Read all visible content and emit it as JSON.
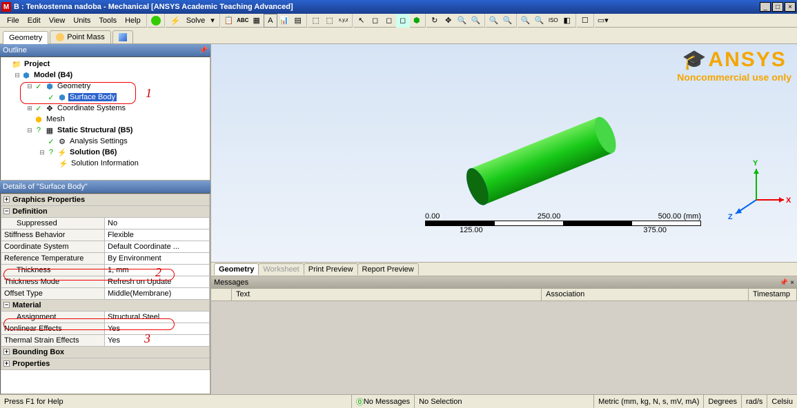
{
  "title": "B : Tenkostenna nadoba - Mechanical [ANSYS Academic Teaching Advanced]",
  "menu": [
    "File",
    "Edit",
    "View",
    "Units",
    "Tools",
    "Help"
  ],
  "solve_label": "Solve",
  "tabs": {
    "geometry": "Geometry",
    "pointmass": "Point Mass"
  },
  "outline_hdr": "Outline",
  "tree": {
    "project": "Project",
    "model": "Model (B4)",
    "geometry": "Geometry",
    "surface_body": "Surface Body",
    "coord": "Coordinate Systems",
    "mesh": "Mesh",
    "static": "Static Structural (B5)",
    "analysis": "Analysis Settings",
    "solution": "Solution (B6)",
    "solinfo": "Solution Information"
  },
  "details_hdr": "Details of \"Surface Body\"",
  "details": {
    "cat_graphics": "Graphics Properties",
    "cat_def": "Definition",
    "suppressed_k": "Suppressed",
    "suppressed_v": "No",
    "stiff_k": "Stiffness Behavior",
    "stiff_v": "Flexible",
    "cs_k": "Coordinate System",
    "cs_v": "Default Coordinate ...",
    "reft_k": "Reference Temperature",
    "reft_v": "By Environment",
    "thk_k": "Thickness",
    "thk_v": "1, mm",
    "thkm_k": "Thickness Mode",
    "thkm_v": "Refresh on Update",
    "off_k": "Offset Type",
    "off_v": "Middle(Membrane)",
    "cat_mat": "Material",
    "asg_k": "Assignment",
    "asg_v": "Structural Steel",
    "nl_k": "Nonlinear Effects",
    "nl_v": "Yes",
    "ts_k": "Thermal Strain Effects",
    "ts_v": "Yes",
    "cat_bb": "Bounding Box",
    "cat_props": "Properties"
  },
  "logo_sub": "Noncommercial use only",
  "ruler": {
    "t0": "0.00",
    "t1": "250.00",
    "t2": "500.00 (mm)",
    "b0": "125.00",
    "b1": "375.00"
  },
  "viewtabs": {
    "geo": "Geometry",
    "ws": "Worksheet",
    "pp": "Print Preview",
    "rp": "Report Preview"
  },
  "msg_hdr": "Messages",
  "msg_cols": {
    "text": "Text",
    "assoc": "Association",
    "ts": "Timestamp"
  },
  "status": {
    "help": "Press F1 for Help",
    "nomsg": "No Messages",
    "nosel": "No Selection",
    "units": "Metric (mm, kg, N, s, mV, mA)",
    "deg": "Degrees",
    "rads": "rad/s",
    "cels": "Celsiu"
  },
  "ann": {
    "a1": "1",
    "a2": "2",
    "a3": "3"
  },
  "triad": {
    "x": "X",
    "y": "Y",
    "z": "Z"
  }
}
